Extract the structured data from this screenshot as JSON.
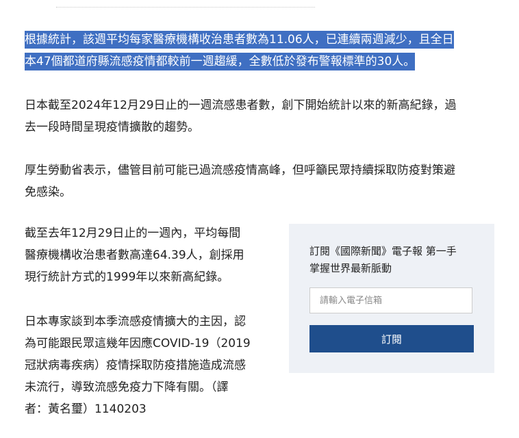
{
  "article": {
    "paragraph1": {
      "line1": "根據統計，該週平均每家醫療機構收治患者數為11.06人，已連續兩週減少，且全日",
      "line2": "本47個都道府縣流感疫情都較前一週趨緩，全數低於發布警報標準的30人。"
    },
    "paragraph2": {
      "line1": "日本截至2024年12月29日止的一週流感患者數，創下開始統計以來的新高紀錄，過",
      "line2": "去一段時間呈現疫情擴散的趨勢。"
    },
    "paragraph3": {
      "line1": "厚生勞動省表示，儘管目前可能已過流感疫情高峰，但呼籲民眾持續採取防疫對策避",
      "line2": "免感染。"
    },
    "paragraph4": {
      "line1": "截至去年12月29日止的一週內，平均每間",
      "line2": "醫療機構收治患者數高達64.39人，創採用",
      "line3": "現行統計方式的1999年以來新高紀錄。"
    },
    "paragraph5": {
      "line1": "日本專家談到本季流感疫情擴大的主因，認",
      "line2": "為可能跟民眾這幾年因應COVID-19（2019",
      "line3": "冠狀病毒疾病）疫情採取防疫措施造成流感",
      "line4": "未流行，導致流感免疫力下降有關。（譯",
      "line5": "者：黃名璽）1140203"
    }
  },
  "sidebar": {
    "promo_line1": "訂閱《國際新聞》電子報 第一手",
    "promo_line2": "掌握世界最新脈動",
    "email_placeholder": "請輸入電子信箱",
    "subscribe_label": "訂閱"
  },
  "colors": {
    "highlight": "#3f6fc2",
    "button": "#1f4e8c",
    "sidebar_bg": "#eef1f6"
  }
}
